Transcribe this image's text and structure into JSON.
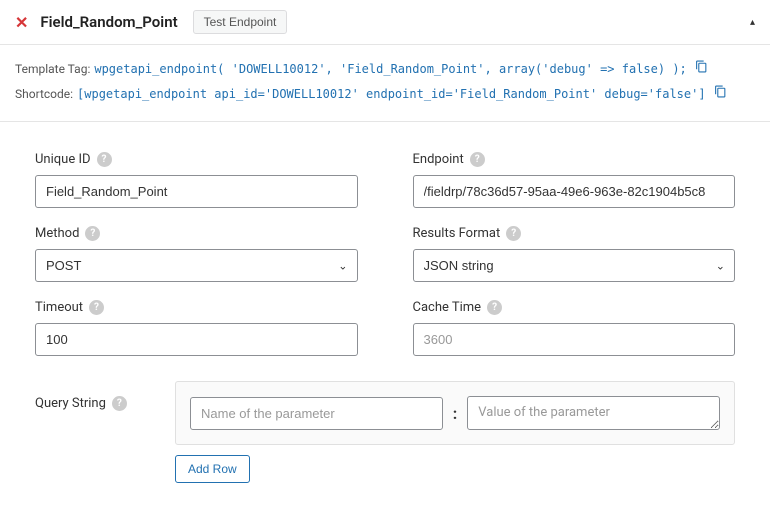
{
  "header": {
    "title": "Field_Random_Point",
    "test_button": "Test Endpoint"
  },
  "info": {
    "template_tag_label": "Template Tag:",
    "template_tag_code": "wpgetapi_endpoint( 'DOWELL10012', 'Field_Random_Point', array('debug' => false) );",
    "shortcode_label": "Shortcode:",
    "shortcode_code": "[wpgetapi_endpoint api_id='DOWELL10012' endpoint_id='Field_Random_Point' debug='false']"
  },
  "fields": {
    "unique_id": {
      "label": "Unique ID",
      "value": "Field_Random_Point"
    },
    "endpoint": {
      "label": "Endpoint",
      "value": "/fieldrp/78c36d57-95aa-49e6-963e-82c1904b5c8"
    },
    "method": {
      "label": "Method",
      "value": "POST"
    },
    "results_format": {
      "label": "Results Format",
      "value": "JSON string"
    },
    "timeout": {
      "label": "Timeout",
      "value": "100"
    },
    "cache_time": {
      "label": "Cache Time",
      "placeholder": "3600",
      "value": ""
    }
  },
  "query": {
    "label": "Query String",
    "name_placeholder": "Name of the parameter",
    "value_placeholder": "Value of the parameter",
    "add_row": "Add Row"
  }
}
